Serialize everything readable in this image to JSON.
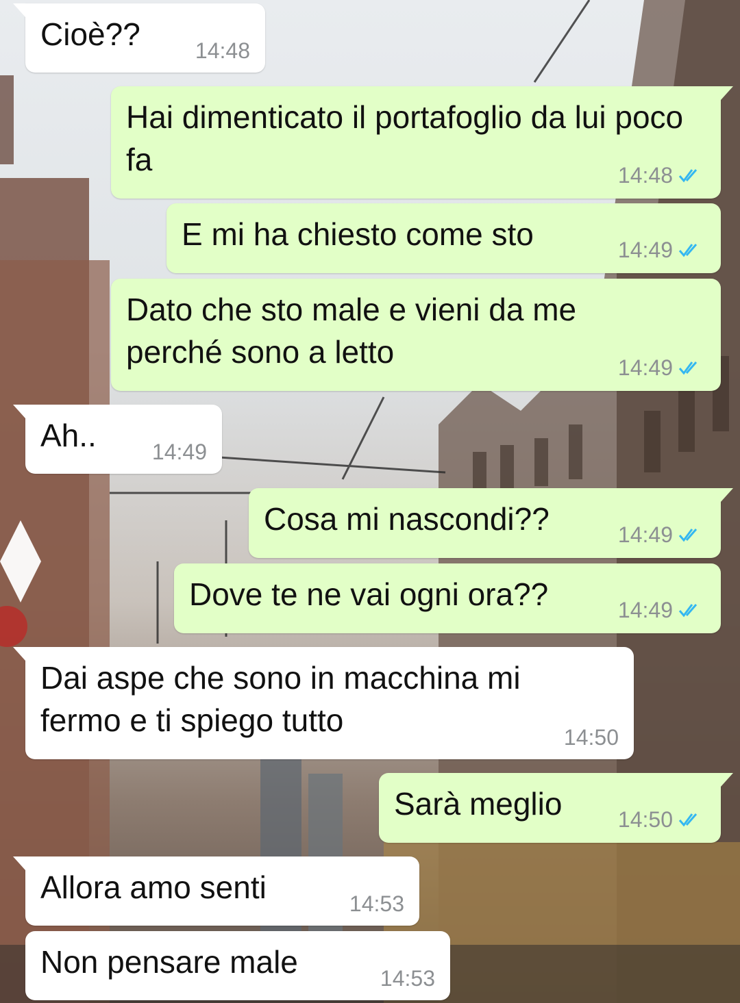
{
  "conversation": {
    "messages": [
      {
        "direction": "in",
        "text": "Cioè??",
        "time": "14:48"
      },
      {
        "direction": "out",
        "text": "Hai dimenticato il portafoglio da lui poco fa",
        "time": "14:48",
        "status": "read"
      },
      {
        "direction": "out",
        "text": "E mi ha chiesto come sto",
        "time": "14:49",
        "status": "read"
      },
      {
        "direction": "out",
        "text": "Dato che sto male e vieni da me perché sono a letto",
        "time": "14:49",
        "status": "read"
      },
      {
        "direction": "in",
        "text": "Ah..",
        "time": "14:49"
      },
      {
        "direction": "out",
        "text": "Cosa mi nascondi??",
        "time": "14:49",
        "status": "read"
      },
      {
        "direction": "out",
        "text": "Dove te ne vai ogni ora??",
        "time": "14:49",
        "status": "read"
      },
      {
        "direction": "in",
        "text": "Dai aspe che sono in macchina mi fermo e ti spiego tutto",
        "time": "14:50"
      },
      {
        "direction": "out",
        "text": "Sarà meglio",
        "time": "14:50",
        "status": "read"
      },
      {
        "direction": "in",
        "text": "Allora amo senti",
        "time": "14:53"
      },
      {
        "direction": "in",
        "text": "Non pensare male",
        "time": "14:53"
      }
    ]
  },
  "colors": {
    "incoming_bubble": "#ffffff",
    "outgoing_bubble": "#e2ffc7",
    "read_ticks": "#34b7f1",
    "timestamp": "#8c8f92"
  },
  "icons": {
    "read_receipt": "double-check-icon"
  }
}
